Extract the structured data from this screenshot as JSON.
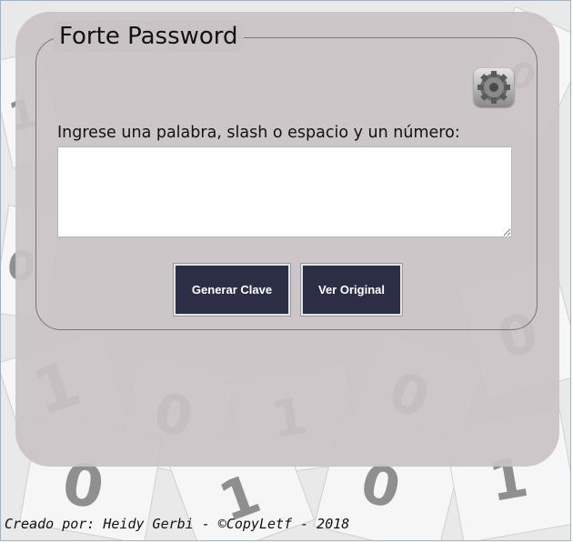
{
  "form": {
    "legend": "Forte Password",
    "prompt_label": "Ingrese una palabra, slash o espacio y un número:",
    "input_value": ""
  },
  "buttons": {
    "generate_label": "Generar Clave",
    "original_label": "Ver Original"
  },
  "footer": {
    "credit": "Creado por: Heidy Gerbi - ©CopyLetf - 2018"
  },
  "icons": {
    "settings": "gear-icon"
  },
  "colors": {
    "panel": "#c9c3c6",
    "button_bg": "#2b2e45",
    "button_text": "#ffffff"
  }
}
